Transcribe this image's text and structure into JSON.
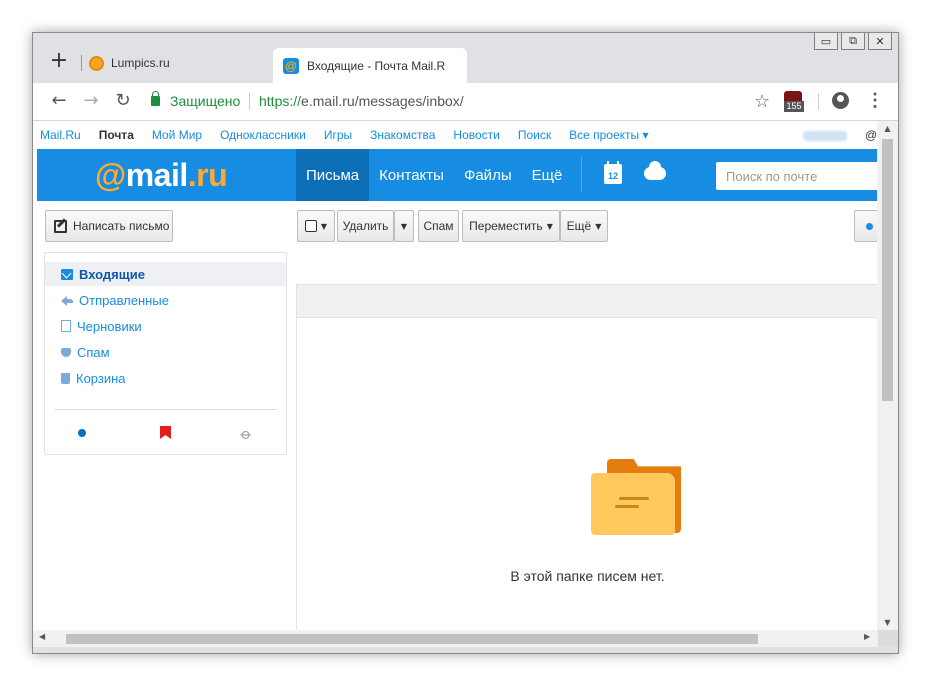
{
  "window": {
    "controls": [
      "▭",
      "⧉",
      "✕"
    ]
  },
  "tabs": [
    {
      "title": "Lumpics.ru"
    },
    {
      "title": "Входящие - Почта Mail.R"
    }
  ],
  "toolbar": {
    "secure_label": "Защищено",
    "url_scheme": "https://",
    "url_rest": "e.mail.ru/messages/inbox/",
    "extension_badge": "155"
  },
  "portal": {
    "links": [
      "Mail.Ru",
      "Почта",
      "Мой Мир",
      "Одноклассники",
      "Игры",
      "Знакомства",
      "Новости",
      "Поиск",
      "Все проекты ▾"
    ],
    "active_index": 1,
    "user_suffix": "@ya"
  },
  "header": {
    "logo_at": "@",
    "logo_name": "mail",
    "logo_dot": ".",
    "logo_tld": "ru",
    "nav": [
      "Письма",
      "Контакты",
      "Файлы",
      "Ещё"
    ],
    "calendar_day": "12",
    "search_placeholder": "Поиск по почте",
    "accent_color": "#168de2"
  },
  "actions": {
    "compose": "Написать письмо",
    "delete": "Удалить",
    "spam": "Спам",
    "move": "Переместить",
    "more": "Ещё"
  },
  "folders": [
    {
      "label": "Входящие",
      "icon": "inbox-icon",
      "active": true
    },
    {
      "label": "Отправленные",
      "icon": "sent-icon"
    },
    {
      "label": "Черновики",
      "icon": "drafts-icon"
    },
    {
      "label": "Спам",
      "icon": "spam-icon"
    },
    {
      "label": "Корзина",
      "icon": "trash-icon"
    }
  ],
  "main": {
    "empty_message": "В этой папке писем нет."
  }
}
